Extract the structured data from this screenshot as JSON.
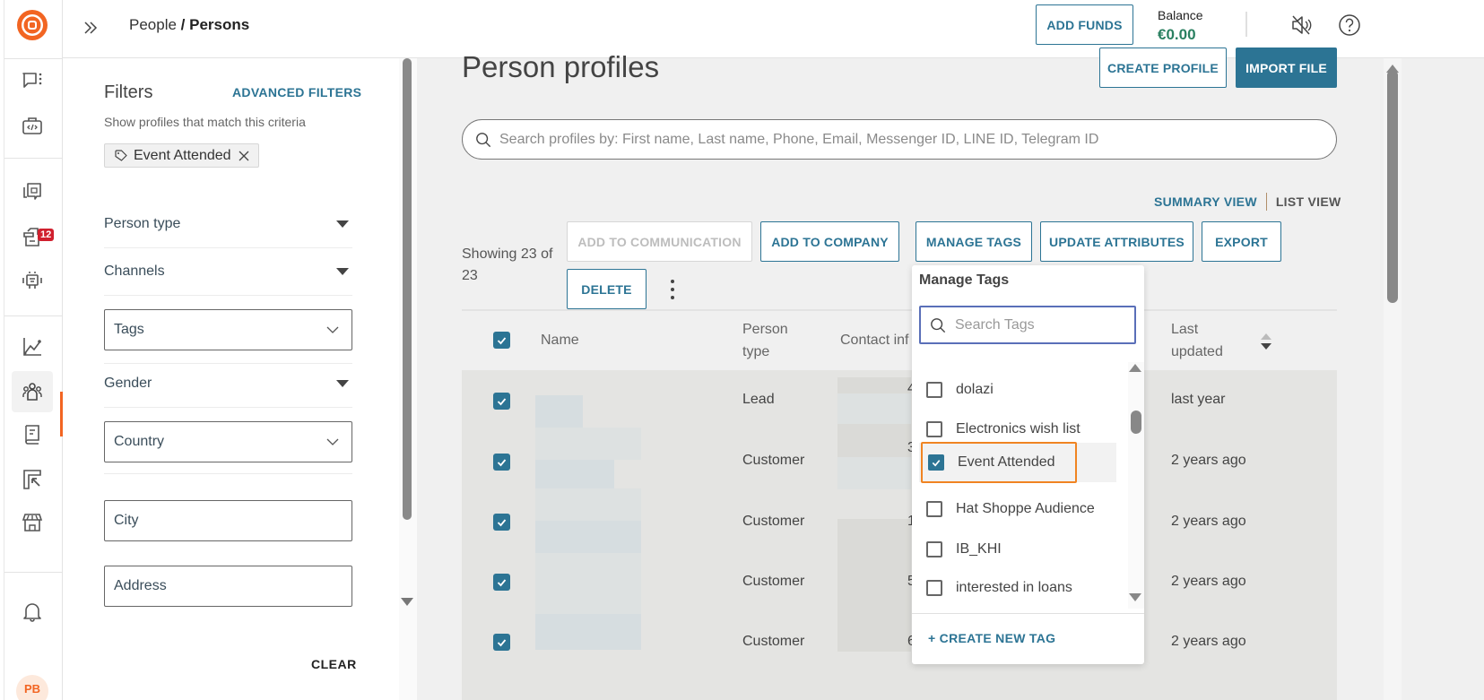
{
  "app": {
    "brand_color": "#f26522",
    "accent_color": "#2c7494"
  },
  "rail": {
    "items": [
      {
        "name": "conversations",
        "icon": "chat-menu-icon"
      },
      {
        "name": "developer",
        "icon": "code-briefcase-icon"
      },
      {
        "name": "templates",
        "icon": "message-templates-icon"
      },
      {
        "name": "inbox",
        "icon": "tickets-icon",
        "badge": "12"
      },
      {
        "name": "bots",
        "icon": "robot-icon"
      },
      {
        "name": "analytics",
        "icon": "chart-line-icon"
      },
      {
        "name": "people",
        "icon": "people-icon",
        "active": true
      },
      {
        "name": "knowledge",
        "icon": "book-icon"
      },
      {
        "name": "campaigns",
        "icon": "layout-cursor-icon"
      },
      {
        "name": "store",
        "icon": "storefront-icon"
      },
      {
        "name": "notifications",
        "icon": "bell-icon"
      }
    ],
    "inbox_badge": "12",
    "avatar_initials": "PB"
  },
  "topbar": {
    "breadcrumb_parent": "People",
    "breadcrumb_sep": " / ",
    "breadcrumb_current": "Persons",
    "add_funds": "ADD FUNDS",
    "balance_label": "Balance",
    "balance_value": "€0.00"
  },
  "filters": {
    "title": "Filters",
    "advanced": "ADVANCED FILTERS",
    "subtitle": "Show profiles that match this criteria",
    "active_chip": "Event Attended",
    "person_type": "Person type",
    "channels": "Channels",
    "tags_placeholder": "Tags",
    "gender": "Gender",
    "country_placeholder": "Country",
    "city_placeholder": "City",
    "address_placeholder": "Address",
    "clear": "CLEAR"
  },
  "main": {
    "title": "Person profiles",
    "create_profile": "CREATE PROFILE",
    "import_file": "IMPORT FILE",
    "search_placeholder": "Search profiles by: First name, Last name, Phone, Email, Messenger ID, LINE ID, Telegram ID",
    "summary_view": "SUMMARY VIEW",
    "list_view": "LIST VIEW",
    "showing": "Showing 23 of 23",
    "actions": {
      "add_to_communication": "ADD TO COMMUNICATION",
      "add_to_company": "ADD TO COMPANY",
      "manage_tags": "MANAGE TAGS",
      "update_attributes": "UPDATE ATTRIBUTES",
      "export": "EXPORT",
      "delete": "DELETE"
    },
    "table": {
      "headers": {
        "name": "Name",
        "person_type_1": "Person",
        "person_type_2": "type",
        "contact_info": "Contact inf",
        "last_updated_1": "Last",
        "last_updated_2": "updated"
      },
      "rows": [
        {
          "person_type": "Lead",
          "contact_digit": "4",
          "last_updated": "last year"
        },
        {
          "person_type": "Customer",
          "contact_digit": "3",
          "last_updated": "2 years ago"
        },
        {
          "person_type": "Customer",
          "contact_digit": "1",
          "last_updated": "2 years ago"
        },
        {
          "person_type": "Customer",
          "contact_digit": "5",
          "last_updated": "2 years ago"
        },
        {
          "person_type": "Customer",
          "contact_digit": "6",
          "last_updated": "2 years ago"
        }
      ]
    }
  },
  "manage_tags": {
    "title": "Manage Tags",
    "search_placeholder": "Search Tags",
    "tags": [
      {
        "label": "dolazi",
        "checked": false
      },
      {
        "label": "Electronics wish list",
        "checked": false
      },
      {
        "label": "Event Attended",
        "checked": true
      },
      {
        "label": "Hat Shoppe Audience",
        "checked": false
      },
      {
        "label": "IB_KHI",
        "checked": false
      },
      {
        "label": "interested in loans",
        "checked": false
      }
    ],
    "create_new": "+ CREATE NEW TAG"
  }
}
